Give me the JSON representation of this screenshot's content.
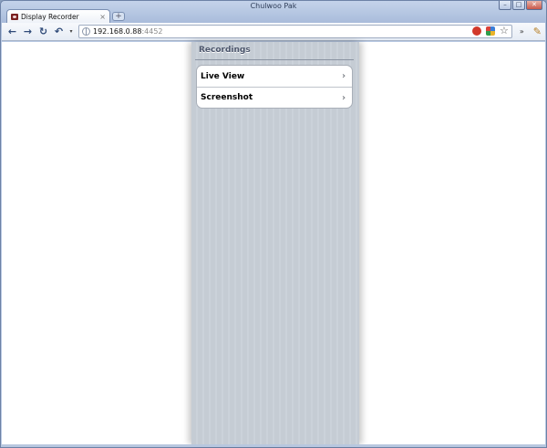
{
  "window": {
    "title": "Chulwoo Pak",
    "buttons": {
      "minimize": "–",
      "maximize": "□",
      "close": "✕"
    }
  },
  "tab": {
    "title": "Display Recorder",
    "close": "×",
    "new_tab": "+"
  },
  "toolbar": {
    "back": "←",
    "forward": "→",
    "reload": "↻",
    "history": "↶",
    "history_dropdown": "▾",
    "url_host": "192.168.0.88",
    "url_port": ":4452",
    "extensions_overflow": "»",
    "wrench": "✎",
    "star": "☆"
  },
  "page": {
    "section_header": "Recordings",
    "items": [
      {
        "label": "Live View",
        "chevron": "›"
      },
      {
        "label": "Screenshot",
        "chevron": "›"
      }
    ]
  },
  "colors": {
    "panel_bg": "#c5ccd4",
    "header_text": "#4c566c",
    "window_frame": "#a9bcdb"
  }
}
